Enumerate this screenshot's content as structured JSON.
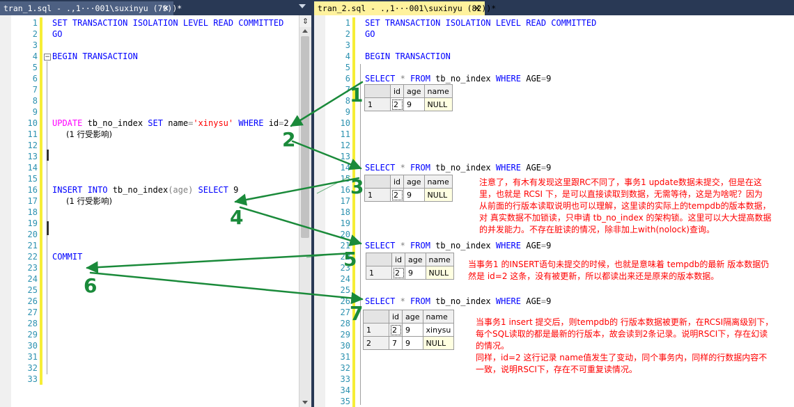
{
  "left": {
    "tab_title": "tran_1.sql - .,1···001\\suxinyu (79))*",
    "tab_close": "✕",
    "line_numbers": [
      "1",
      "2",
      "3",
      "4",
      "5",
      "6",
      "7",
      "8",
      "9",
      "10",
      "11",
      "12",
      "13",
      "14",
      "15",
      "16",
      "17",
      "18",
      "19",
      "20",
      "21",
      "22",
      "23",
      "24",
      "25",
      "26",
      "27",
      "28",
      "29",
      "30",
      "31",
      "32",
      "33"
    ],
    "code": {
      "l1": "SET TRANSACTION ISOLATION LEVEL READ COMMITTED",
      "l2": "GO",
      "l4": "BEGIN TRANSACTION",
      "l11_kw": "UPDATE",
      "l11_a": " tb_no_index ",
      "l11_set": "SET",
      "l11_b": " name",
      "l11_eq": "=",
      "l11_str": "'xinysu'",
      "l11_where": " WHERE",
      "l11_c": " id",
      "l11_eq2": "=",
      "l11_d": "2",
      "l12": "(1 行受影响)",
      "l17_kw": "INSERT INTO",
      "l17_a": " tb_no_index",
      "l17_p": "(age)",
      "l17_sel": " SELECT",
      "l17_b": " 9",
      "l18": "(1 行受影响)",
      "l23": "COMMIT"
    }
  },
  "right": {
    "tab_title": "tran_2.sql - .,1···001\\suxinyu (82))*",
    "tab_close": "✕",
    "line_numbers": [
      "1",
      "2",
      "3",
      "4",
      "5",
      "6",
      "7",
      "8",
      "9",
      "10",
      "11",
      "12",
      "13",
      "14",
      "15",
      "16",
      "17",
      "18",
      "19",
      "20",
      "21",
      "22",
      "23",
      "24",
      "25",
      "26",
      "27",
      "28",
      "29",
      "30",
      "31",
      "32",
      "33",
      "34",
      "35"
    ],
    "code": {
      "l1": "SET TRANSACTION ISOLATION LEVEL READ COMMITTED",
      "l2": "GO",
      "l4": "BEGIN TRANSACTION",
      "select_kw": "SELECT",
      "star": " * ",
      "from_kw": "FROM",
      "table": " tb_no_index ",
      "where_kw": "WHERE",
      "cond_a": " AGE",
      "cond_eq": "=",
      "cond_b": "9"
    },
    "grid_headers": [
      "id",
      "age",
      "name"
    ],
    "grid1": [
      [
        "1",
        "2",
        "9",
        "NULL"
      ]
    ],
    "grid2": [
      [
        "1",
        "2",
        "9",
        "NULL"
      ]
    ],
    "grid3": [
      [
        "1",
        "2",
        "9",
        "NULL"
      ]
    ],
    "grid4": [
      [
        "1",
        "2",
        "9",
        "xinysu"
      ],
      [
        "2",
        "7",
        "9",
        "NULL"
      ]
    ]
  },
  "notes": {
    "n1": [
      "注意了，有木有发现这里跟RC不同了，事务1 update数据未提交，但是在这",
      "里，也就是 RCSI 下，是可以直接读取到数据，无需等待，这是为啥呢？因为",
      "从前面的行版本读取说明也可以理解，这里读的实际上的tempdb的版本数据，",
      "对 真实数据不加锁读，只申请 tb_no_index 的架构锁。这里可以大大提高数据",
      "的并发能力。不存在脏读的情况，除非加上with(nolock)查询。"
    ],
    "n2": [
      "当事务1 的INSERT语句未提交的时候，也就是意味着 tempdb的最新 版本数据仍",
      "然是 id=2 这条，没有被更新，所以都读出来还是原来的版本数据。"
    ],
    "n3": [
      "当事务1 insert 提交后，则tempdb的 行版本数据被更新，在RCSI隔离级别下，",
      "每个SQL读取的都是最新的行版本，故会读到2条记录。说明RSCI下，存在幻读",
      "的情况。",
      "同样，id=2 这行记录 name值发生了变动，同个事务内，同样的行数据内容不",
      "一致，说明RSCI下，存在不可重复读情况。"
    ]
  },
  "markers": [
    "1",
    "2",
    "3",
    "4",
    "5",
    "6",
    "7"
  ],
  "colors": {
    "tab_bar": "#293955",
    "active_tab": "#fff29d",
    "keyword": "#0000ff",
    "string": "#ff0000",
    "line_number": "#2b91af",
    "annotation": "#ff0000",
    "arrow": "#1a8a3a"
  }
}
